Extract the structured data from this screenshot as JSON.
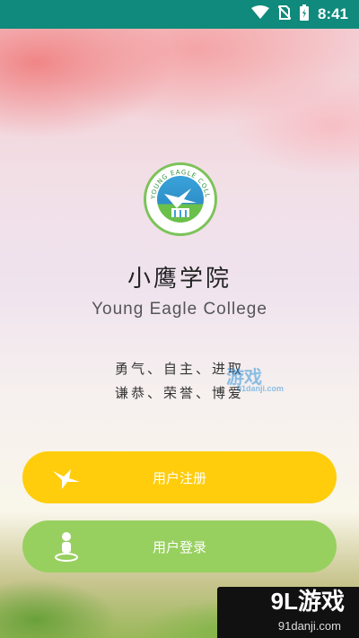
{
  "status_bar": {
    "time": "8:41",
    "icons": [
      "wifi-icon",
      "no-sim-icon",
      "battery-icon"
    ]
  },
  "logo": {
    "ring_text": "YOUNG EAGLE COLLEGE"
  },
  "app": {
    "title": "小鹰学院",
    "subtitle": "Young  Eagle College",
    "motto_line1": "勇气、自主、进取",
    "motto_line2": "谦恭、荣誉、博爱"
  },
  "buttons": {
    "register_label": "用户注册",
    "register_color": "#ffcd0b",
    "register_icon": "eagle-icon",
    "login_label": "用户登录",
    "login_color": "#98d060",
    "login_icon": "person-icon"
  },
  "watermark": {
    "mid_text": "游戏",
    "mid_small": "91danji.com",
    "corner_big": "9L游戏",
    "corner_small": "91danji.com"
  },
  "colors": {
    "status_bar": "#0f8a7c",
    "title": "#222222"
  }
}
